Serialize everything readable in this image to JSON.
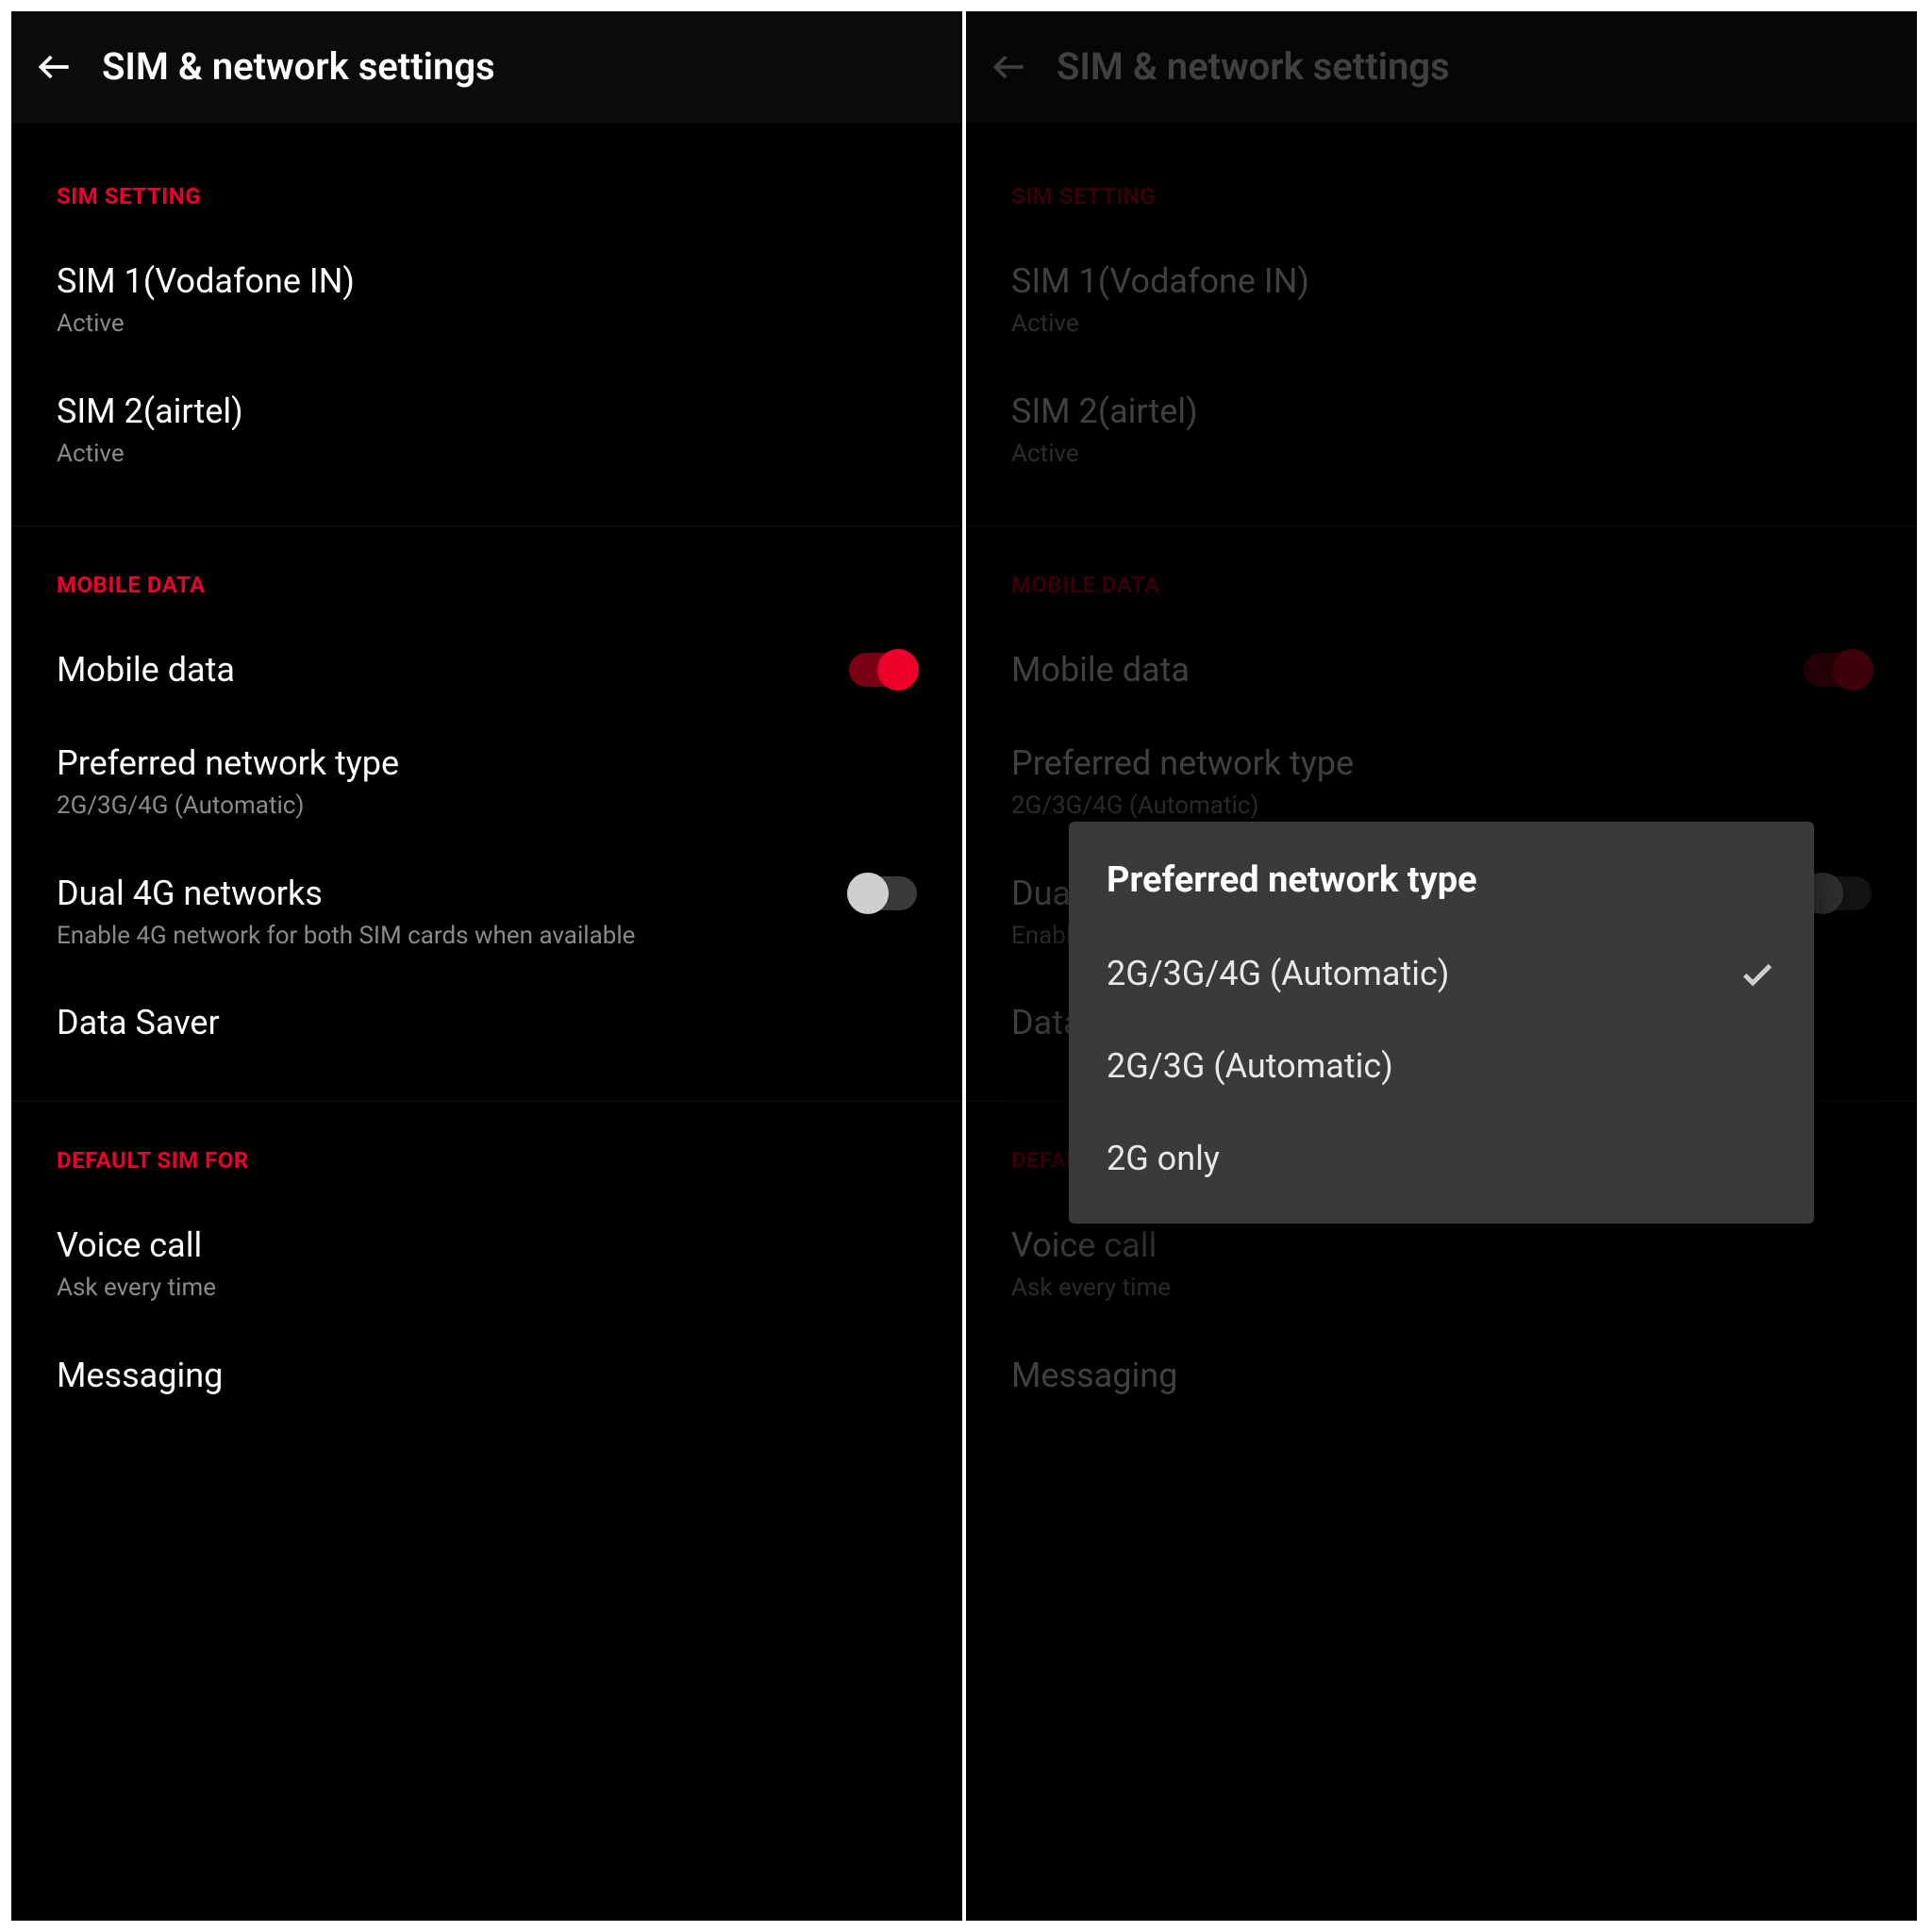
{
  "header": {
    "title": "SIM & network settings"
  },
  "sections": {
    "sim_setting": {
      "title": "SIM SETTING",
      "sim1": {
        "title": "SIM 1(Vodafone IN)",
        "status": "Active"
      },
      "sim2": {
        "title": "SIM 2(airtel)",
        "status": "Active"
      }
    },
    "mobile_data": {
      "title": "MOBILE DATA",
      "mobile_data": {
        "title": "Mobile data"
      },
      "preferred_network": {
        "title": "Preferred network type",
        "sub": "2G/3G/4G (Automatic)"
      },
      "dual_4g": {
        "title": "Dual 4G networks",
        "sub": "Enable 4G network for both SIM cards when available"
      },
      "data_saver": {
        "title": "Data Saver"
      }
    },
    "default_sim": {
      "title": "DEFAULT SIM FOR",
      "voice": {
        "title": "Voice call",
        "sub": "Ask every time"
      },
      "messaging": {
        "title": "Messaging"
      }
    }
  },
  "dialog": {
    "title": "Preferred network type",
    "options": [
      {
        "label": "2G/3G/4G (Automatic)",
        "selected": true
      },
      {
        "label": "2G/3G (Automatic)",
        "selected": false
      },
      {
        "label": "2G only",
        "selected": false
      }
    ]
  }
}
